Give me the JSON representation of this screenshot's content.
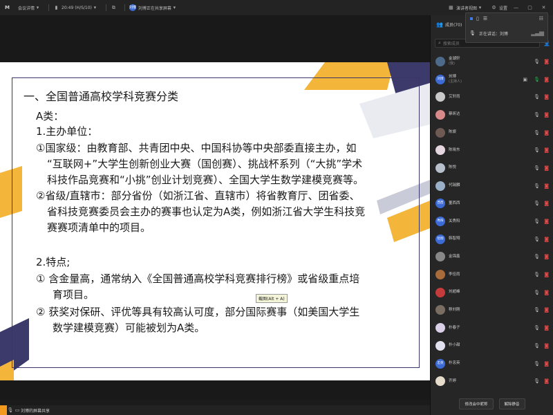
{
  "topbar": {
    "logo_glyph": "M",
    "meeting_details": "会议详情",
    "duration": "20:49 (H/S/10)",
    "share_status": "刘博正在共享屏幕",
    "share_avatar": "刘博",
    "speaker_view": "演讲者视图",
    "settings": "设置"
  },
  "slide": {
    "heading": "一、全国普通高校学科竞赛分类",
    "lines": [
      "A类：",
      "1.主办单位：",
      "①国家级：由教育部、共青团中央、中国科协等中央部委直接主办，如",
      "“互联网+”大学生创新创业大赛（国创赛）、挑战杯系列（“大挑”学术",
      "科技作品竞赛和“小挑”创业计划竞赛）、全国大学生数学建模竞赛等。",
      "②省级/直辖市：部分省份（如浙江省、直辖市）将省教育厅、团省委、",
      "省科技竞赛委员会主办的赛事也认定为A类，例如浙江省大学生科技竞",
      "赛赛项清单中的项目。",
      "2.特点;",
      "① 含金量高，通常纳入《全国普通高校学科竞赛排行榜》或省级重点培",
      "育项目。",
      "② 获奖对保研、评优等具有较高认可度，部分国际赛事（如美国大学生",
      "数学建模竞赛）可能被划为A类。"
    ],
    "tooltip": "截图(Alt + A)",
    "colors": {
      "frame": "#3a3568",
      "yellow": "#f3b63a",
      "navy": "#3b3a6b",
      "gray": "#c9ccd8"
    }
  },
  "bottombar": {
    "label": "刘博的屏幕共享"
  },
  "popover": {
    "speaking": "正在讲话：刘博"
  },
  "members": {
    "title": "成员(70)",
    "search_placeholder": "搜索成员",
    "list": [
      {
        "name": "金湖轩",
        "role": "(我)",
        "avatar_text": "",
        "avatar_color": "#4d6a8a"
      },
      {
        "name": "刘博",
        "role": "(主持人)",
        "avatar_text": "刘博",
        "avatar_color": "#3d6bd6"
      },
      {
        "name": "艾轩雨",
        "role": "",
        "avatar_text": "",
        "avatar_color": "#c9c9c9"
      },
      {
        "name": "蔡昕达",
        "role": "",
        "avatar_text": "",
        "avatar_color": "#d88a8a"
      },
      {
        "name": "陈娱",
        "role": "",
        "avatar_text": "",
        "avatar_color": "#6e5a52"
      },
      {
        "name": "陈晓东",
        "role": "",
        "avatar_text": "",
        "avatar_color": "#e6d6e0"
      },
      {
        "name": "陈悦",
        "role": "",
        "avatar_text": "",
        "avatar_color": "#b8c0cc"
      },
      {
        "name": "代瑞麟",
        "role": "",
        "avatar_text": "",
        "avatar_color": "#9ab0c8"
      },
      {
        "name": "董西西",
        "role": "",
        "avatar_text": "西西",
        "avatar_color": "#3d6bd6"
      },
      {
        "name": "关秀阳",
        "role": "",
        "avatar_text": "秀阳",
        "avatar_color": "#3d6bd6"
      },
      {
        "name": "韩智翔",
        "role": "",
        "avatar_text": "智翔",
        "avatar_color": "#3d6bd6"
      },
      {
        "name": "金锦鑫",
        "role": "",
        "avatar_text": "",
        "avatar_color": "#888"
      },
      {
        "name": "李佳雨",
        "role": "",
        "avatar_text": "",
        "avatar_color": "#a86b3a"
      },
      {
        "name": "刘超峰",
        "role": "",
        "avatar_text": "",
        "avatar_color": "#c43b3b"
      },
      {
        "name": "穆刘刚",
        "role": "",
        "avatar_text": "",
        "avatar_color": "#7a6e62"
      },
      {
        "name": "朴春子",
        "role": "",
        "avatar_text": "",
        "avatar_color": "#d9cfe6"
      },
      {
        "name": "朴小甜",
        "role": "",
        "avatar_text": "",
        "avatar_color": "#e0e0ee"
      },
      {
        "name": "朴忠英",
        "role": "",
        "avatar_text": "忠英",
        "avatar_color": "#3d6bd6"
      },
      {
        "name": "齐婷",
        "role": "",
        "avatar_text": "",
        "avatar_color": "#e6dccc"
      }
    ],
    "buttons": {
      "rename": "修改会中昵称",
      "unmute": "解除静音"
    }
  }
}
